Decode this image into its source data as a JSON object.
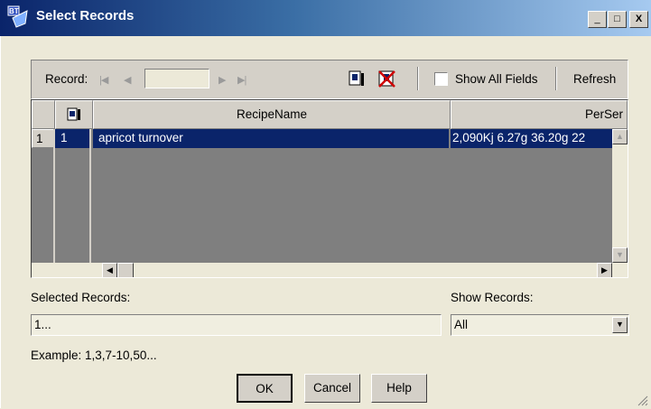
{
  "window": {
    "title": "Select Records",
    "minimize_glyph": "_",
    "maximize_glyph": "□",
    "close_glyph": "X"
  },
  "nav": {
    "record_label": "Record:",
    "record_value": "",
    "first_glyph": "|◀",
    "prev_glyph": "◀",
    "next_glyph": "▶",
    "last_glyph": "▶|",
    "show_all_fields_label": "Show All Fields",
    "show_all_fields_checked": false,
    "refresh_label": "Refresh"
  },
  "grid": {
    "columns": [
      "RecipeName",
      "PerSer"
    ],
    "rows": [
      {
        "index": "1",
        "id": "1",
        "recipe_name": "apricot turnover",
        "per_serving": "2,090Kj 6.27g  36.20g  22"
      }
    ]
  },
  "selected": {
    "label": "Selected Records:",
    "value": "1...",
    "example": "Example: 1,3,7-10,50..."
  },
  "show_records": {
    "label": "Show Records:",
    "value": "All"
  },
  "buttons": {
    "ok": "OK",
    "cancel": "Cancel",
    "help": "Help"
  }
}
